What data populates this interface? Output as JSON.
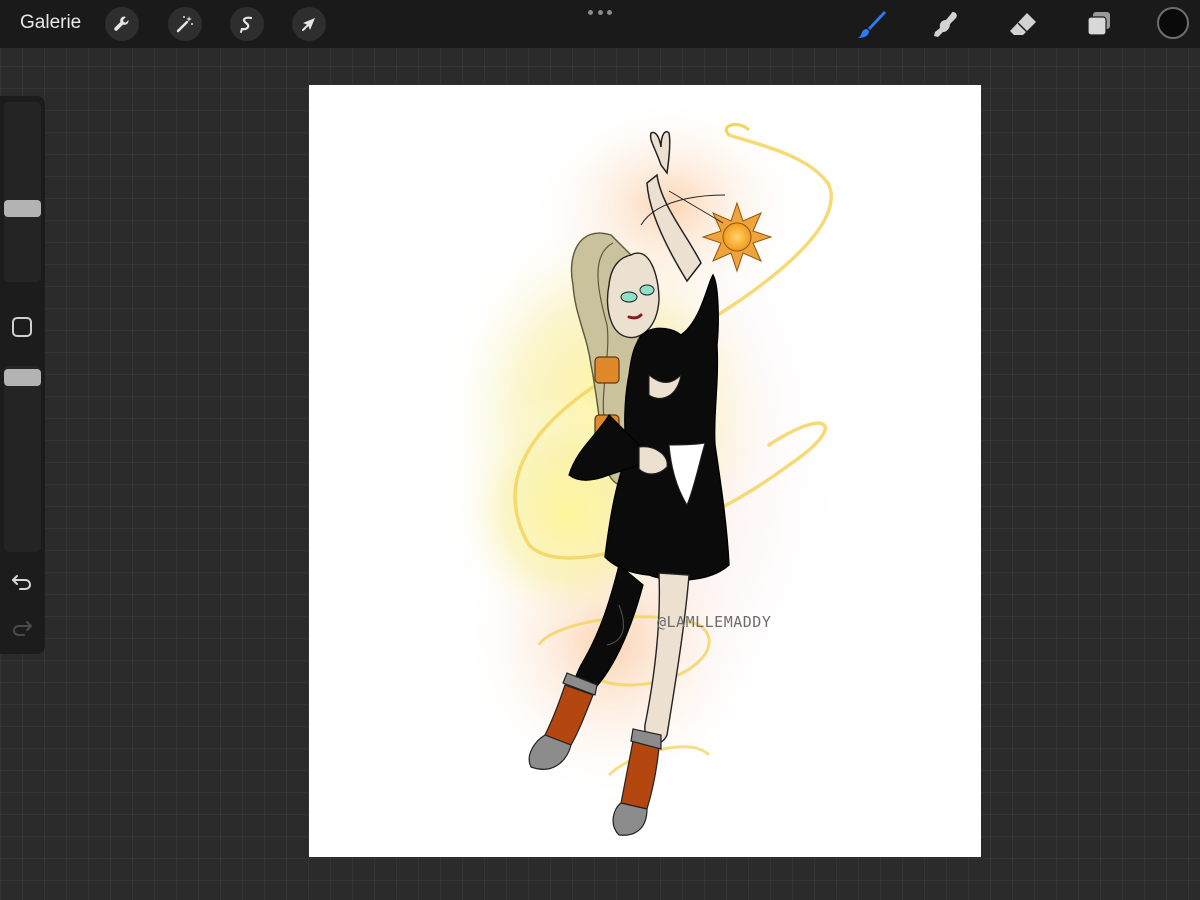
{
  "topbar": {
    "gallery_label": "Galerie",
    "left_tools": [
      "wrench-icon",
      "magic-wand-icon",
      "selection-icon",
      "transform-arrow-icon"
    ],
    "right_tools": [
      "brush-icon",
      "smudge-icon",
      "eraser-icon",
      "layers-icon"
    ],
    "active_tool": "brush",
    "active_color": "#0a0a0a",
    "accent": "#2f7bf5"
  },
  "sidebar": {
    "brush_size_level": 0.4,
    "opacity_level": 0.98,
    "undo_icon": "undo-arrow-icon",
    "redo_icon": "redo-arrow-icon"
  },
  "artwork": {
    "signature": "@LAMLLEMADDY"
  }
}
